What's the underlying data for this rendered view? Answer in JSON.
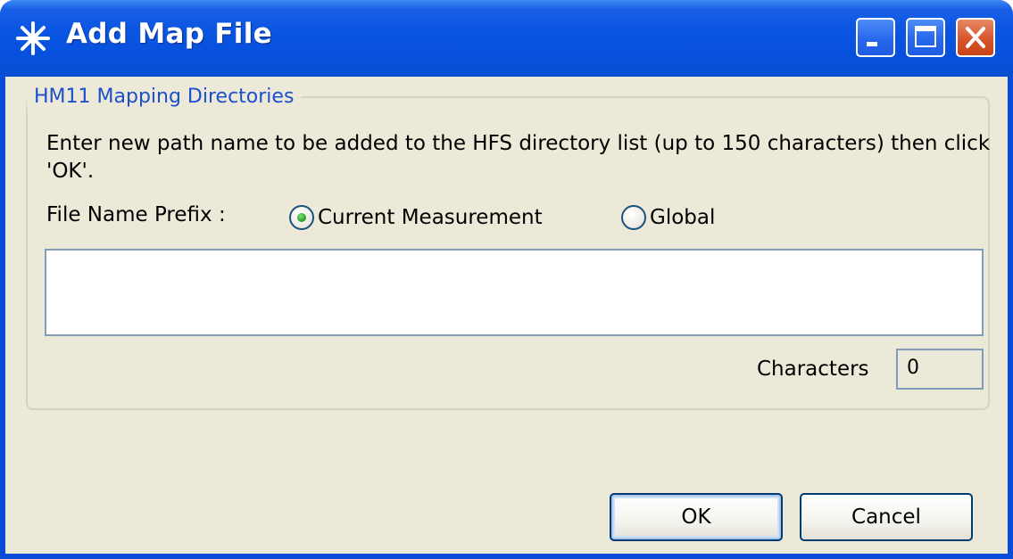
{
  "window": {
    "title": "Add Map File",
    "title_icon": "asterisk-app-icon",
    "controls": {
      "minimize_icon": "minimize-icon",
      "maximize_icon": "maximize-icon",
      "close_icon": "close-icon"
    }
  },
  "group": {
    "title": "HM11 Mapping Directories",
    "instructions": "Enter new path name to be added to the HFS directory list (up to 150 characters) then click 'OK'.",
    "prefix_label": "File Name Prefix :",
    "radio_options": [
      {
        "label": "Current Measurement",
        "selected": true
      },
      {
        "label": "Global",
        "selected": false
      }
    ],
    "path_input_value": "",
    "characters_label": "Characters",
    "characters_value": "0"
  },
  "buttons": {
    "ok_label": "OK",
    "cancel_label": "Cancel"
  },
  "colors": {
    "titlebar": "#0a55e2",
    "client_background": "#ece9d8",
    "group_title": "#1c4fcf",
    "close_button": "#d8552a"
  }
}
